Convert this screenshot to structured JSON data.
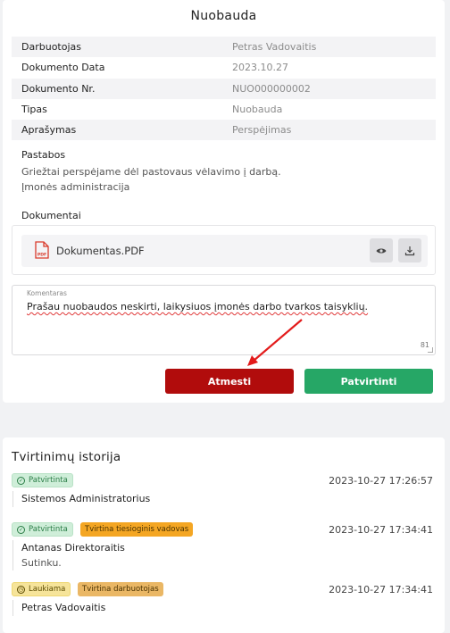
{
  "page": {
    "title": "Nuobauda"
  },
  "info": [
    {
      "label": "Darbuotojas",
      "value": "Petras Vadovaitis"
    },
    {
      "label": "Dokumento Data",
      "value": "2023.10.27"
    },
    {
      "label": "Dokumento Nr.",
      "value": "NUO000000002"
    },
    {
      "label": "Tipas",
      "value": "Nuobauda"
    },
    {
      "label": "Aprašymas",
      "value": "Perspėjimas"
    }
  ],
  "notes": {
    "label": "Pastabos",
    "lines": [
      "Griežtai perspėjame dėl pastovaus vėlavimo į darbą.",
      "Įmonės administracija"
    ]
  },
  "documents": {
    "label": "Dokumentai",
    "file_name": "Dokumentas.PDF",
    "file_icon_text": "PDF",
    "view_icon": "eye-icon",
    "download_icon": "download-icon"
  },
  "comment": {
    "label": "Komentaras",
    "value": "Prašau nuobaudos neskirti, laikysiuos įmonės darbo tvarkos taisyklių.",
    "char_count": "81"
  },
  "actions": {
    "reject_label": "Atmesti",
    "approve_label": "Patvirtinti"
  },
  "history": {
    "title": "Tvirtinimų istorija",
    "entries": [
      {
        "badges": [
          {
            "text": "Patvirtinta",
            "icon": "check-circle-icon"
          }
        ],
        "time": "2023-10-27 17:26:57",
        "name": "Sistemos Administratorius",
        "comment": ""
      },
      {
        "badges": [
          {
            "text": "Patvirtinta",
            "icon": "check-circle-icon"
          },
          {
            "text": "Tvirtina tiesioginis vadovas"
          }
        ],
        "time": "2023-10-27 17:34:41",
        "name": "Antanas Direktoraitis",
        "comment": "Sutinku."
      },
      {
        "badges": [
          {
            "text": "Laukiama",
            "icon": "clock-icon"
          },
          {
            "text": "Tvirtina darbuotojas"
          }
        ],
        "time": "2023-10-27 17:34:41",
        "name": "Petras Vadovaitis",
        "comment": ""
      }
    ]
  },
  "colors": {
    "reject": "#b10c0c",
    "approve": "#26a766",
    "annotation_arrow": "#e31b1b"
  }
}
